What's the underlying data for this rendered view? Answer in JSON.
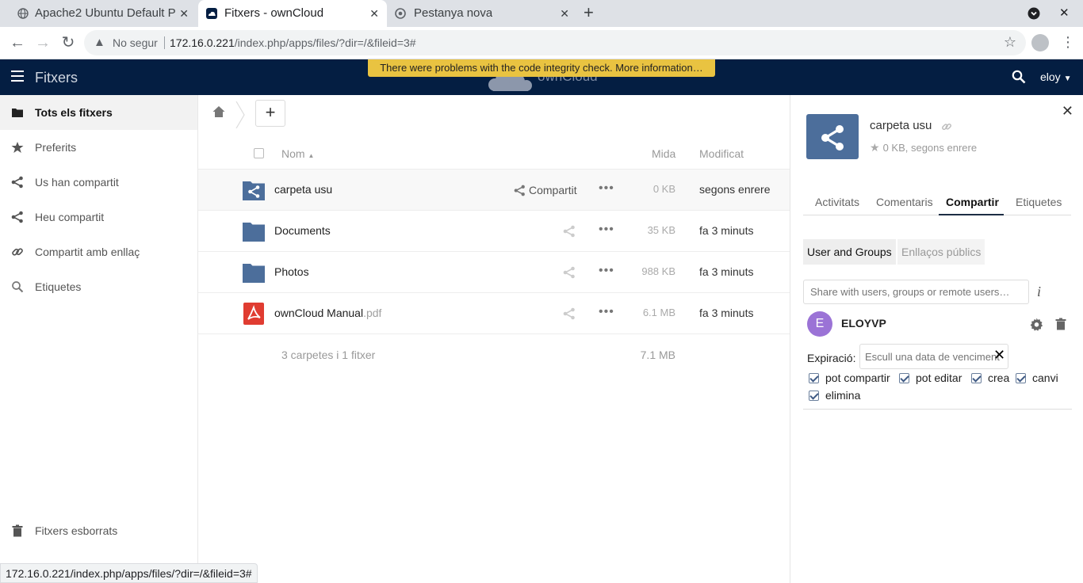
{
  "browser": {
    "tabs": [
      {
        "title": "Apache2 Ubuntu Default P",
        "active": false
      },
      {
        "title": "Fitxers - ownCloud",
        "active": true
      },
      {
        "title": "Pestanya nova",
        "active": false
      }
    ],
    "security_label": "No segur",
    "url_host": "172.16.0.221",
    "url_path": "/index.php/apps/files/?dir=/&fileid=3#",
    "status_url": "172.16.0.221/index.php/apps/files/?dir=/&fileid=3#"
  },
  "header": {
    "app_name": "Fitxers",
    "logo_text": "ownCloud",
    "banner": "There were problems with the code integrity check. More information…",
    "user": "eloy",
    "colors": {
      "header_bg": "#041e42",
      "banner_bg": "#e9c341"
    }
  },
  "sidebar": {
    "items": [
      {
        "label": "Tots els fitxers",
        "icon": "folder-icon",
        "active": true
      },
      {
        "label": "Preferits",
        "icon": "star-icon"
      },
      {
        "label": "Us han compartit",
        "icon": "share-icon"
      },
      {
        "label": "Heu compartit",
        "icon": "share-icon"
      },
      {
        "label": "Compartit amb enllaç",
        "icon": "link-icon"
      },
      {
        "label": "Etiquetes",
        "icon": "tag-search-icon"
      }
    ],
    "bottom_items": [
      {
        "label": "Fitxers esborrats",
        "icon": "trash-icon"
      }
    ]
  },
  "files": {
    "columns": {
      "name": "Nom",
      "size": "Mida",
      "modified": "Modificat"
    },
    "rows": [
      {
        "name": "carpeta usu",
        "ext": "",
        "type": "shared-folder",
        "share_label": "Compartit",
        "size": "0 KB",
        "modified": "segons enrere",
        "selected": true
      },
      {
        "name": "Documents",
        "ext": "",
        "type": "folder",
        "share_label": "",
        "size": "35 KB",
        "modified": "fa 3 minuts"
      },
      {
        "name": "Photos",
        "ext": "",
        "type": "folder",
        "share_label": "",
        "size": "988 KB",
        "modified": "fa 3 minuts"
      },
      {
        "name": "ownCloud Manual",
        "ext": ".pdf",
        "type": "pdf",
        "share_label": "",
        "size": "6.1 MB",
        "modified": "fa 3 minuts"
      }
    ],
    "summary": {
      "text": "3 carpetes i 1 fitxer",
      "size": "7.1 MB"
    },
    "new_button": "+"
  },
  "details": {
    "name": "carpeta usu",
    "meta": "0 KB, segons enrere",
    "tabs": [
      "Activitats",
      "Comentaris",
      "Compartir",
      "Etiquetes"
    ],
    "active_tab": "Compartir",
    "subtabs": {
      "users": "User and Groups",
      "links": "Enllaços públics"
    },
    "share_placeholder": "Share with users, groups or remote users…",
    "share_entry": {
      "avatar_letter": "E",
      "user": "ELOYVP",
      "expiry_label": "Expiració:",
      "expiry_placeholder": "Escull una data de venciment",
      "permissions": [
        {
          "label": "pot compartir",
          "checked": true
        },
        {
          "label": "pot editar",
          "checked": true
        },
        {
          "label": "crea",
          "checked": true
        },
        {
          "label": "canvi",
          "checked": true
        },
        {
          "label": "elimina",
          "checked": true
        }
      ]
    }
  }
}
